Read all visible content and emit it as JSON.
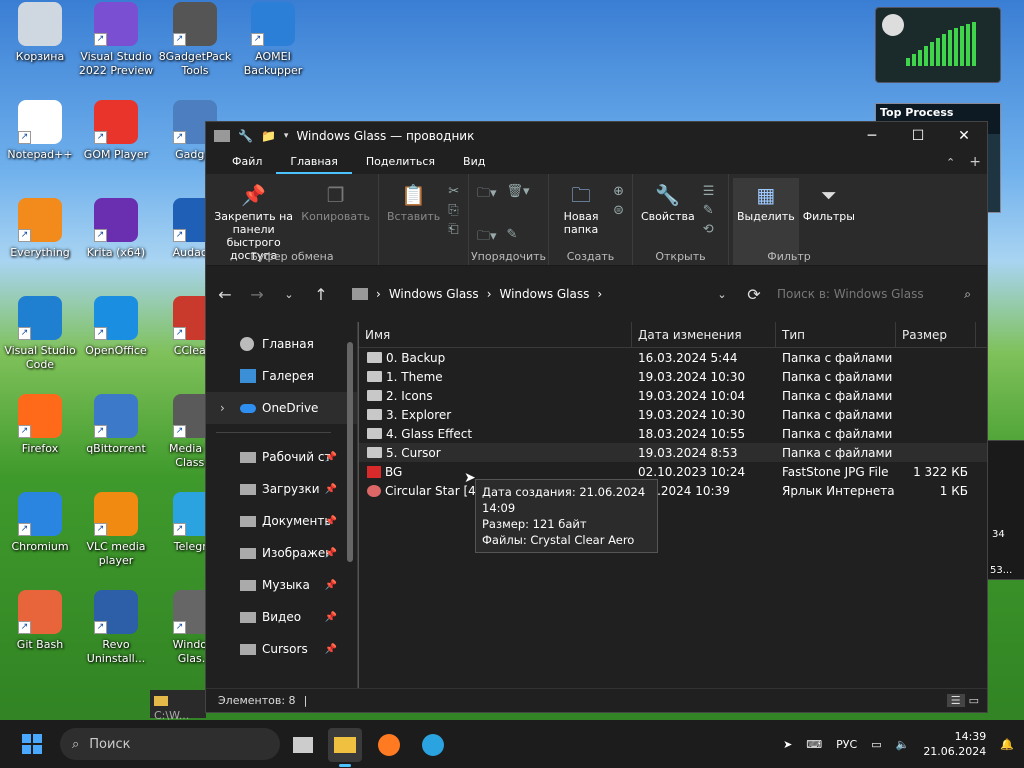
{
  "desktop_icons": [
    {
      "label": "Корзина"
    },
    {
      "label": "Visual Studio 2022 Preview"
    },
    {
      "label": "8GadgetPack Tools"
    },
    {
      "label": "AOMEI Backupper"
    },
    {
      "label": "Notepad++"
    },
    {
      "label": "GOM Player"
    },
    {
      "label": "Gadg..."
    },
    {
      "label": "Everything"
    },
    {
      "label": "Krita (x64)"
    },
    {
      "label": "Audac..."
    },
    {
      "label": "Visual Studio Code"
    },
    {
      "label": "OpenOffice"
    },
    {
      "label": "CClea..."
    },
    {
      "label": "Firefox"
    },
    {
      "label": "qBittorrent"
    },
    {
      "label": "Media P... Class..."
    },
    {
      "label": "Chromium"
    },
    {
      "label": "VLC media player"
    },
    {
      "label": "Telegr..."
    },
    {
      "label": "Git Bash"
    },
    {
      "label": "Revo Uninstall..."
    },
    {
      "label": "Windo... Glas..."
    }
  ],
  "gadgets": {
    "top_process_title": "Top Process Monitor",
    "side_label_1": "34",
    "side_label_2": "53..."
  },
  "window": {
    "title": "Windows Glass — проводник",
    "controls": {
      "minimize": "─",
      "maximize": "☐",
      "close": "✕"
    },
    "menu": [
      "Файл",
      "Главная",
      "Поделиться",
      "Вид"
    ],
    "ribbon": {
      "clipboard": {
        "pin": "Закрепить на панели быстрого доступа",
        "copy": "Копировать",
        "paste": "Вставить",
        "group": "Буфер обмена"
      },
      "organize": {
        "group": "Упорядочить"
      },
      "create": {
        "new_folder": "Новая папка",
        "group": "Создать"
      },
      "open": {
        "properties": "Свойства",
        "group": "Открыть"
      },
      "select": {
        "select": "Выделить",
        "filters": "Фильтры",
        "group": "Фильтр"
      }
    },
    "address": {
      "crumbs": [
        "Windows Glass",
        "Windows Glass"
      ],
      "search_placeholder": "Поиск в: Windows Glass"
    },
    "nav": {
      "top": [
        "Главная",
        "Галерея",
        "OneDrive"
      ],
      "pinned": [
        "Рабочий ст...",
        "Загрузки",
        "Документы",
        "Изображен...",
        "Музыка",
        "Видео",
        "Cursors"
      ]
    },
    "columns": {
      "name": "Имя",
      "date": "Дата изменения",
      "type": "Тип",
      "size": "Размер"
    },
    "files": [
      {
        "name": "0. Backup",
        "date": "16.03.2024 5:44",
        "type": "Папка с файлами",
        "size": ""
      },
      {
        "name": "1. Theme",
        "date": "19.03.2024 10:30",
        "type": "Папка с файлами",
        "size": ""
      },
      {
        "name": "2. Icons",
        "date": "19.03.2024 10:04",
        "type": "Папка с файлами",
        "size": ""
      },
      {
        "name": "3. Explorer",
        "date": "19.03.2024 10:30",
        "type": "Папка с файлами",
        "size": ""
      },
      {
        "name": "4. Glass Effect",
        "date": "18.03.2024 10:55",
        "type": "Папка с файлами",
        "size": ""
      },
      {
        "name": "5. Cursor",
        "date": "19.03.2024 8:53",
        "type": "Папка с файлами",
        "size": ""
      },
      {
        "name": "BG",
        "date": "02.10.2023 10:24",
        "type": "FastStone JPG File",
        "size": "1 322 КБ"
      },
      {
        "name": "Circular Star [4K]",
        "date": "...3.2024 10:39",
        "type": "Ярлык Интернета",
        "size": "1 КБ"
      }
    ],
    "tooltip": [
      "Дата создания: 21.06.2024 14:09",
      "Размер: 121 байт",
      "Файлы: Crystal Clear Aero"
    ],
    "status": "Элементов: 8"
  },
  "background_window_path": "C:\\W...",
  "taskbar": {
    "search": "Поиск",
    "lang": "РУС",
    "time": "14:39",
    "date": "21.06.2024"
  }
}
